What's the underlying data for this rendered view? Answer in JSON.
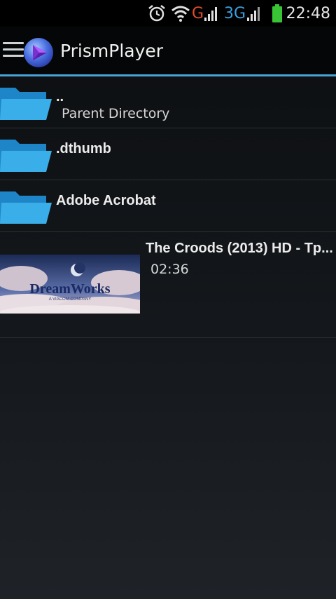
{
  "status_bar": {
    "time": "22:48",
    "network_g": "G",
    "network_3g": "3G",
    "icons": [
      "alarm-icon",
      "wifi-icon",
      "signal-g-icon",
      "signal-3g-icon",
      "battery-icon"
    ],
    "colors": {
      "g": "#e24b2b",
      "threeg": "#3aa0e0",
      "battery": "#39c436"
    }
  },
  "action_bar": {
    "title": "PrismPlayer",
    "accent_color": "#4aa3d6"
  },
  "files": [
    {
      "name": "..",
      "subtitle": "Parent Directory",
      "icon": "folder-icon"
    },
    {
      "name": ".dthumb",
      "icon": "folder-icon"
    },
    {
      "name": "Adobe Acrobat",
      "icon": "folder-icon"
    }
  ],
  "video": {
    "title": "The Croods (2013) HD - Tp...",
    "duration": "02:36",
    "thumbnail_logo": "DreamWorks",
    "thumbnail_sub": "A VIACOM COMPANY"
  }
}
